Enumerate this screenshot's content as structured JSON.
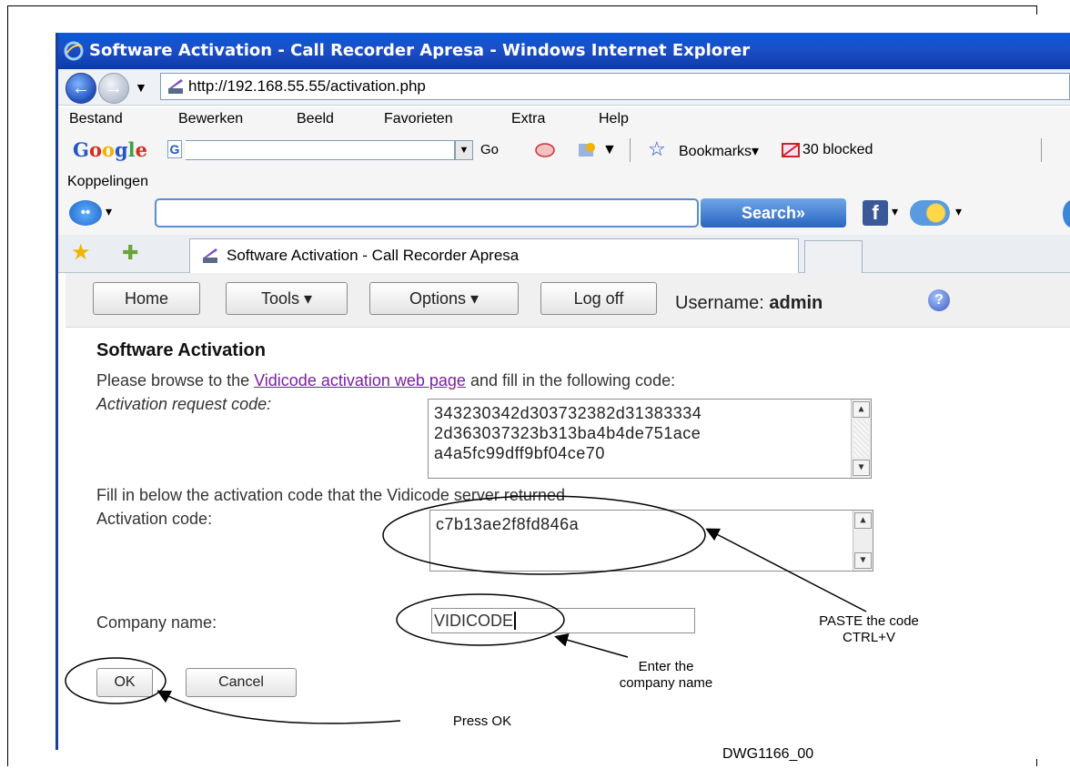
{
  "window": {
    "title": "Software Activation - Call Recorder Apresa - Windows Internet Explorer",
    "url": "http://192.168.55.55/activation.php"
  },
  "menu": [
    "Bestand",
    "Bewerken",
    "Beeld",
    "Favorieten",
    "Extra",
    "Help"
  ],
  "google_toolbar": {
    "logo": "Google",
    "go_label": "Go",
    "bookmarks_label": "Bookmarks",
    "blocked_label": "30 blocked"
  },
  "links_label": "Koppelingen",
  "search_toolbar": {
    "search_button": "Search»"
  },
  "tab": {
    "label": "Software Activation - Call Recorder Apresa"
  },
  "app_toolbar": {
    "home": "Home",
    "tools": "Tools ▾",
    "options": "Options ▾",
    "logoff": "Log off",
    "username_label": "Username:",
    "username_value": "admin"
  },
  "form": {
    "heading": "Software Activation",
    "instruction_pre": "Please browse to the ",
    "instruction_link": "Vidicode activation web page",
    "instruction_post": " and fill in the following code:",
    "request_label": "Activation request code:",
    "request_code_lines": [
      "343230342d303732382d31383334",
      "2d363037323b313ba4b4de751ace",
      "a4a5fc99dff9bf04ce70"
    ],
    "fill_instruction": "Fill in below the activation code that the Vidicode server returned",
    "activation_label": "Activation code:",
    "activation_value": "c7b13ae2f8fd846a",
    "company_label": "Company name:",
    "company_value": "VIDICODE",
    "ok_label": "OK",
    "cancel_label": "Cancel"
  },
  "annotations": {
    "paste_line1": "PASTE the code",
    "paste_line2": "CTRL+V",
    "enter_line1": "Enter the",
    "enter_line2": "company name",
    "press_ok": "Press OK"
  },
  "drawing_number": "DWG1166_00"
}
